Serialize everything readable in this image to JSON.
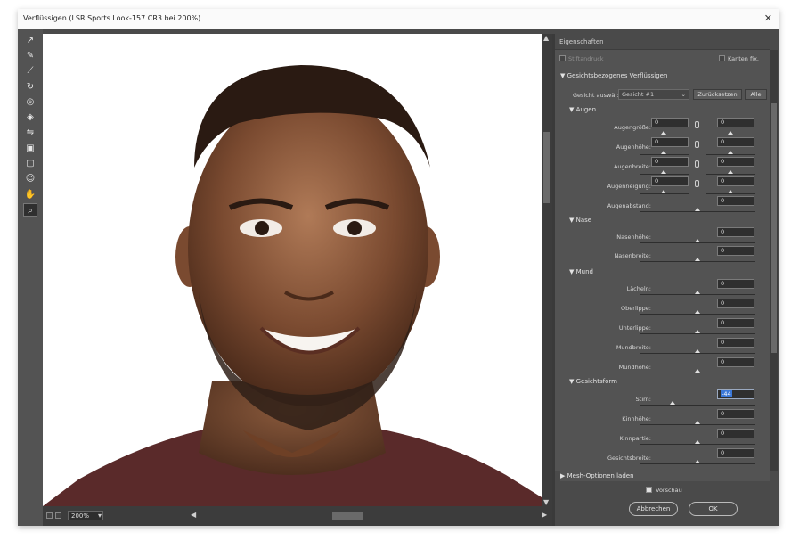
{
  "window": {
    "title": "Verflüssigen (LSR Sports Look-157.CR3 bei 200%)",
    "close": "✕"
  },
  "tools": [
    {
      "name": "forward-warp-icon",
      "glyph": "↗"
    },
    {
      "name": "reconstruct-icon",
      "glyph": "✎"
    },
    {
      "name": "smooth-icon",
      "glyph": "⟋"
    },
    {
      "name": "twirl-icon",
      "glyph": "↻"
    },
    {
      "name": "pucker-icon",
      "glyph": "◎"
    },
    {
      "name": "bloat-icon",
      "glyph": "◈"
    },
    {
      "name": "push-left-icon",
      "glyph": "⇋"
    },
    {
      "name": "freeze-mask-icon",
      "glyph": "▣"
    },
    {
      "name": "thaw-mask-icon",
      "glyph": "▢"
    },
    {
      "name": "face-tool-icon",
      "glyph": "☺"
    },
    {
      "name": "hand-icon",
      "glyph": "✋"
    },
    {
      "name": "zoom-icon",
      "glyph": "⌕"
    }
  ],
  "status": {
    "zoom": "200%"
  },
  "panel": {
    "title": "Eigenschaften",
    "pin_edges": "Stiftandruck",
    "edges_fix": "Kanten fix.",
    "face_aware": "Gesichtsbezogenes Verflüssigen",
    "face_select_label": "Gesicht auswä.:",
    "face_select_value": "Gesicht #1",
    "reset": "Zurücksetzen",
    "all": "Alle",
    "eyes": {
      "title": "Augen",
      "rows": [
        {
          "label": "Augengröße:",
          "left": "0",
          "right": "0"
        },
        {
          "label": "Augenhöhe:",
          "left": "0",
          "right": "0"
        },
        {
          "label": "Augenbreite:",
          "left": "0",
          "right": "0"
        },
        {
          "label": "Augenneigung:",
          "left": "0",
          "right": "0"
        },
        {
          "label": "Augenabstand:",
          "value": "0"
        }
      ]
    },
    "nose": {
      "title": "Nase",
      "rows": [
        {
          "label": "Nasenhöhe:",
          "value": "0"
        },
        {
          "label": "Nasenbreite:",
          "value": "0"
        }
      ]
    },
    "mouth": {
      "title": "Mund",
      "rows": [
        {
          "label": "Lächeln:",
          "value": "0"
        },
        {
          "label": "Oberlippe:",
          "value": "0"
        },
        {
          "label": "Unterlippe:",
          "value": "0"
        },
        {
          "label": "Mundbreite:",
          "value": "0"
        },
        {
          "label": "Mundhöhe:",
          "value": "0"
        }
      ]
    },
    "faceshape": {
      "title": "Gesichtsform",
      "rows": [
        {
          "label": "Stirn:",
          "value": "-44"
        },
        {
          "label": "Kinnhöhe:",
          "value": "0"
        },
        {
          "label": "Kinnpartie:",
          "value": "0"
        },
        {
          "label": "Gesichtsbreite:",
          "value": "0"
        }
      ]
    },
    "mesh": "Mesh-Optionen laden"
  },
  "footer": {
    "preview": "Vorschau",
    "cancel": "Abbrechen",
    "ok": "OK"
  }
}
